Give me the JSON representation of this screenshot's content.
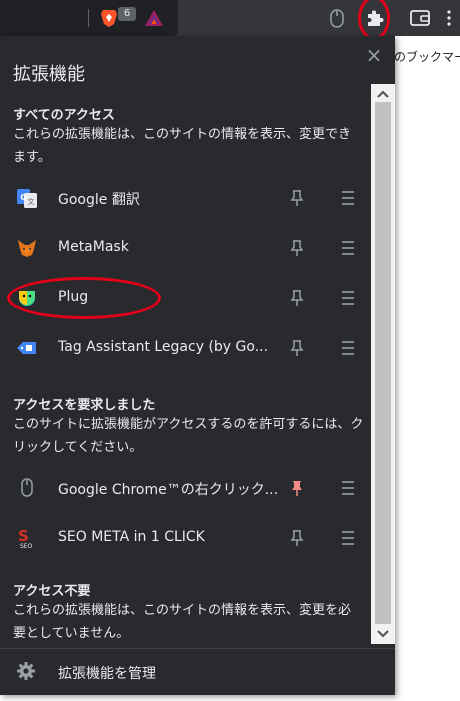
{
  "toolbar": {
    "brave_badge": "6",
    "bookmark_hint": "のブックマーク"
  },
  "popup": {
    "title": "拡張機能",
    "close_label": "×",
    "sections": [
      {
        "title": "すべてのアクセス",
        "desc_line1": "これらの拡張機能は、このサイトの情報を表示、変更でき",
        "desc_line2": "ます。",
        "items": [
          {
            "name": "Google 翻訳",
            "pinned": false
          },
          {
            "name": "MetaMask",
            "pinned": false
          },
          {
            "name": "Plug",
            "pinned": false
          },
          {
            "name": "Tag Assistant Legacy (by Go...",
            "pinned": false
          }
        ]
      },
      {
        "title": "アクセスを要求しました",
        "desc_line1": "このサイトに拡張機能がアクセスするのを許可するには、ク",
        "desc_line2": "リックしてください。",
        "items": [
          {
            "name": "Google Chrome™の右クリック...",
            "pinned": true
          },
          {
            "name": "SEO META in 1 CLICK",
            "pinned": false
          }
        ]
      },
      {
        "title": "アクセス不要",
        "desc_line1": "これらの拡張機能は、このサイトの情報を表示、変更を必",
        "desc_line2": "要としていません。"
      }
    ],
    "footer_label": "拡張機能を管理"
  },
  "colors": {
    "popup_bg": "#292a2d",
    "highlight_ring": "#e2001a",
    "pinned_color": "#f28b82"
  }
}
